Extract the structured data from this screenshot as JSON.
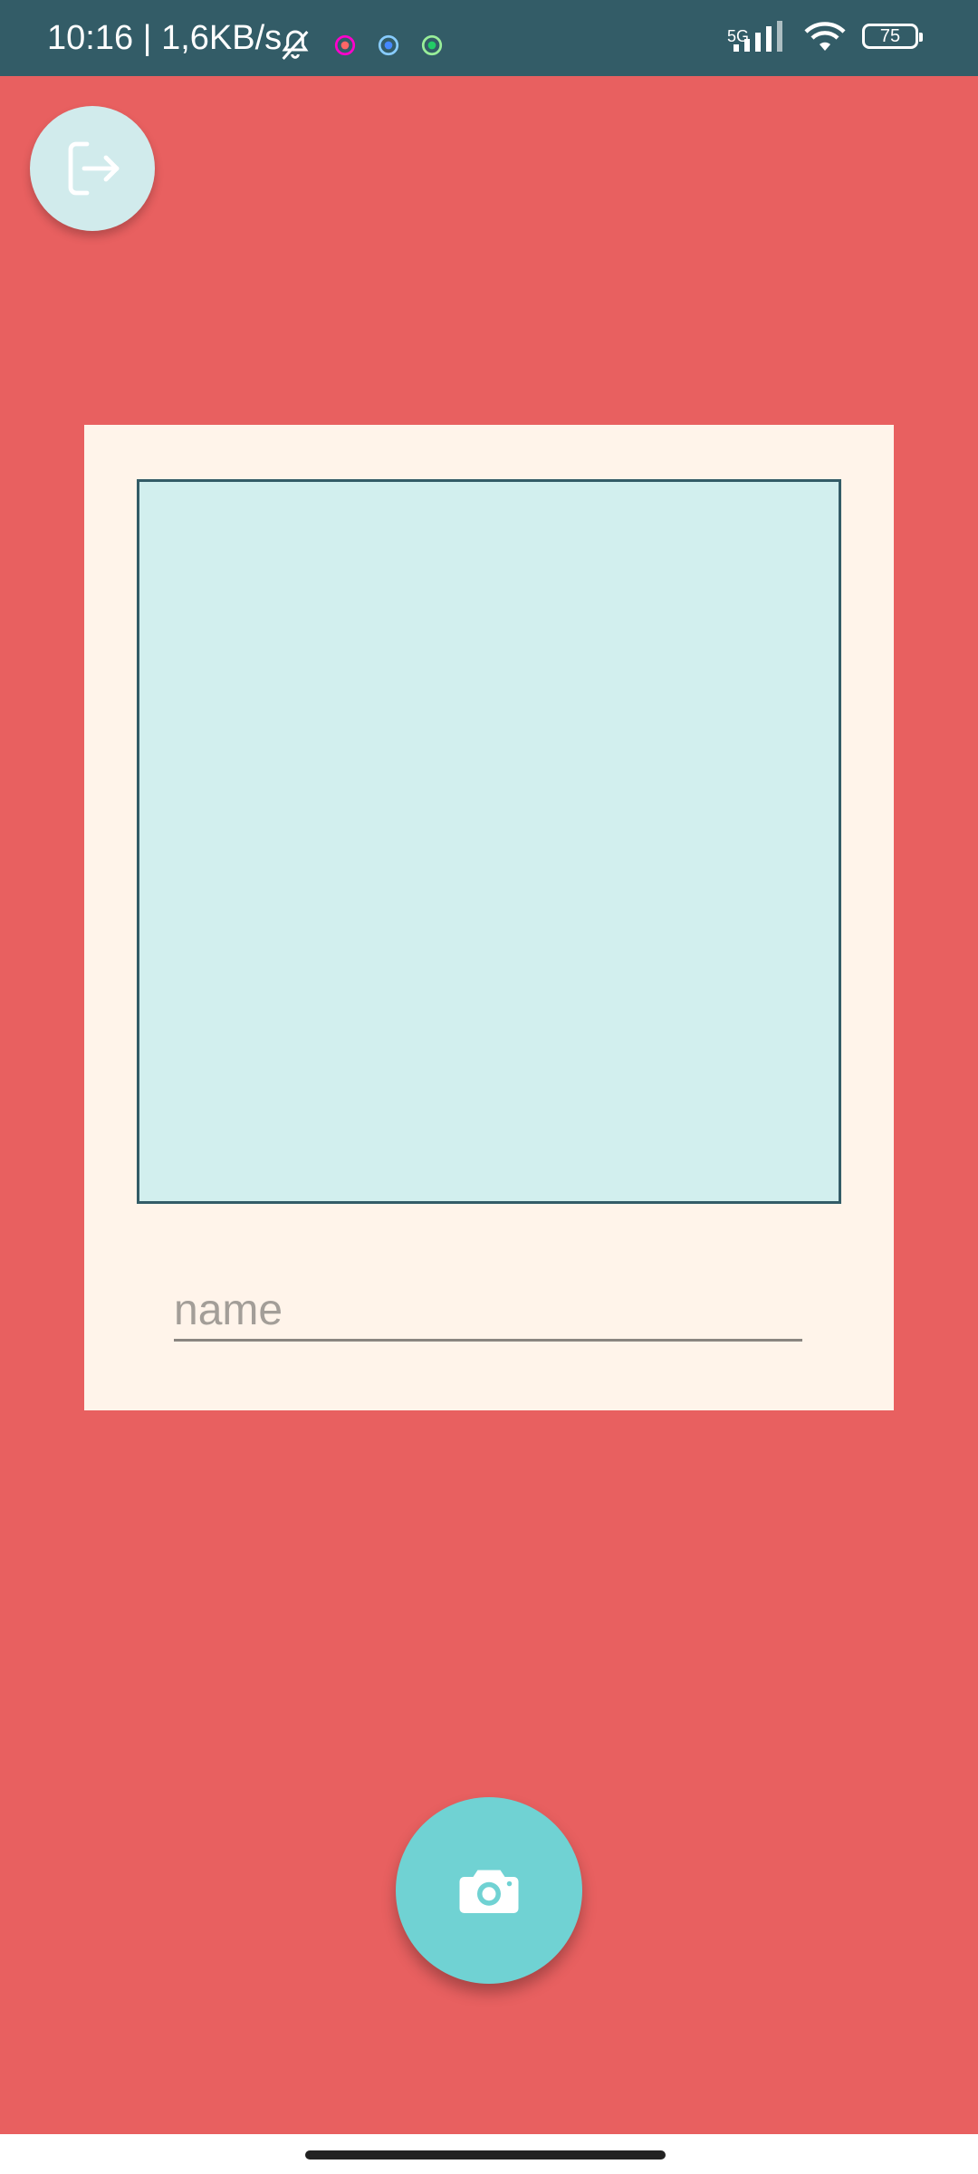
{
  "status_bar": {
    "time": "10:16 | 1,6KB/s",
    "network_label": "5G",
    "battery_level": "75",
    "icons": [
      "bell-off-icon",
      "app-notification-icon",
      "app-notification-icon",
      "app-notification-icon",
      "signal-icon",
      "wifi-icon",
      "battery-icon"
    ]
  },
  "logout": {
    "icon": "logout-icon"
  },
  "card": {
    "name_placeholder": "name"
  },
  "camera": {
    "icon": "camera-icon"
  },
  "colors": {
    "background": "#e86060",
    "status_bar": "#335c67",
    "card": "#fff4ea",
    "photo_frame": "#d2efee",
    "photo_border": "#335c67",
    "logout_button": "#d1ebec",
    "camera_button": "#70d2d3"
  }
}
